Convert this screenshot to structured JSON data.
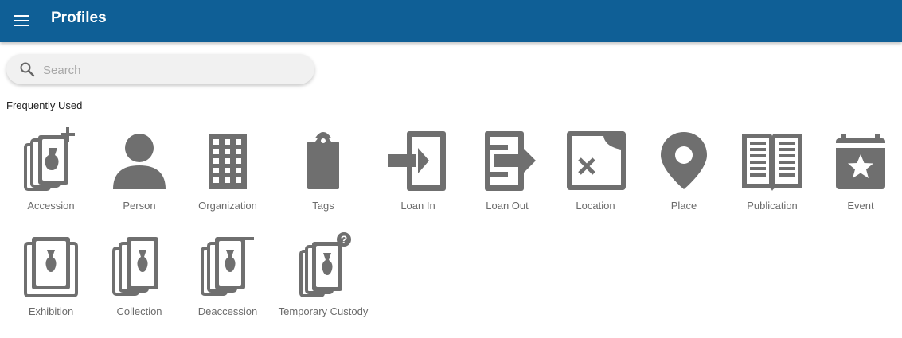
{
  "header": {
    "title": "Profiles",
    "menu_icon": "hamburger-menu-icon",
    "background": "#0f5f96"
  },
  "search": {
    "placeholder": "Search",
    "value": ""
  },
  "section": {
    "label": "Frequently Used"
  },
  "profiles_row1": [
    {
      "label": "Accession",
      "icon": "accession-icon"
    },
    {
      "label": "Person",
      "icon": "person-icon"
    },
    {
      "label": "Organization",
      "icon": "organization-icon"
    },
    {
      "label": "Tags",
      "icon": "tag-icon"
    },
    {
      "label": "Loan In",
      "icon": "loan-in-icon"
    },
    {
      "label": "Loan Out",
      "icon": "loan-out-icon"
    },
    {
      "label": "Location",
      "icon": "location-icon"
    },
    {
      "label": "Place",
      "icon": "place-pin-icon"
    },
    {
      "label": "Publication",
      "icon": "publication-book-icon"
    },
    {
      "label": "Event",
      "icon": "event-calendar-icon"
    }
  ],
  "profiles_row2": [
    {
      "label": "Exhibition",
      "icon": "exhibition-icon"
    },
    {
      "label": "Collection",
      "icon": "collection-icon"
    },
    {
      "label": "Deaccession",
      "icon": "deaccession-icon"
    },
    {
      "label": "Temporary Custody",
      "icon": "temporary-custody-icon"
    }
  ]
}
